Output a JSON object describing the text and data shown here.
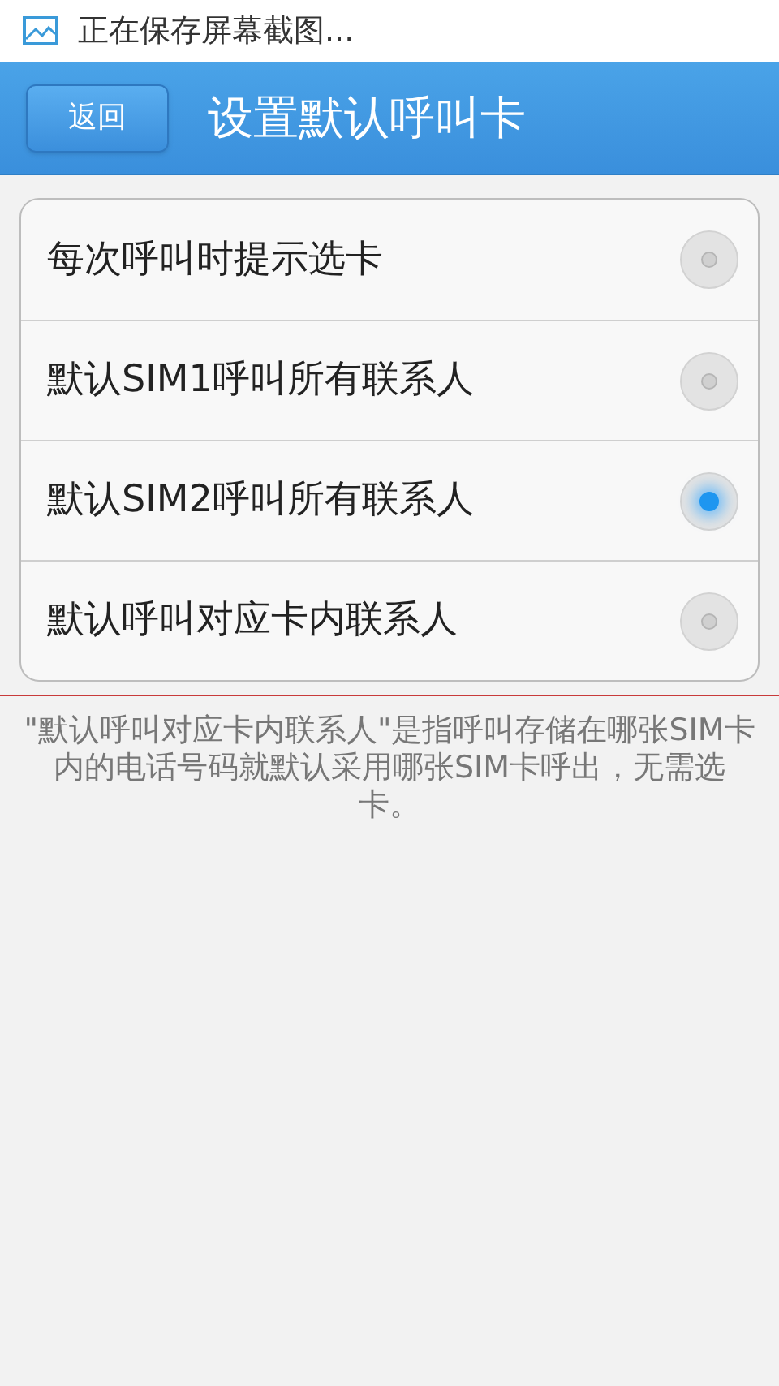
{
  "notification": {
    "text": "正在保存屏幕截图..."
  },
  "header": {
    "back_button": "返回",
    "title": "设置默认呼叫卡"
  },
  "options": [
    {
      "label": "每次呼叫时提示选卡",
      "selected": false
    },
    {
      "label": "默认SIM1呼叫所有联系人",
      "selected": false
    },
    {
      "label": "默认SIM2呼叫所有联系人",
      "selected": true
    },
    {
      "label": "默认呼叫对应卡内联系人",
      "selected": false
    }
  ],
  "note": "\"默认呼叫对应卡内联系人\"是指呼叫存储在哪张SIM卡内的电话号码就默认采用哪张SIM卡呼出，无需选卡。"
}
